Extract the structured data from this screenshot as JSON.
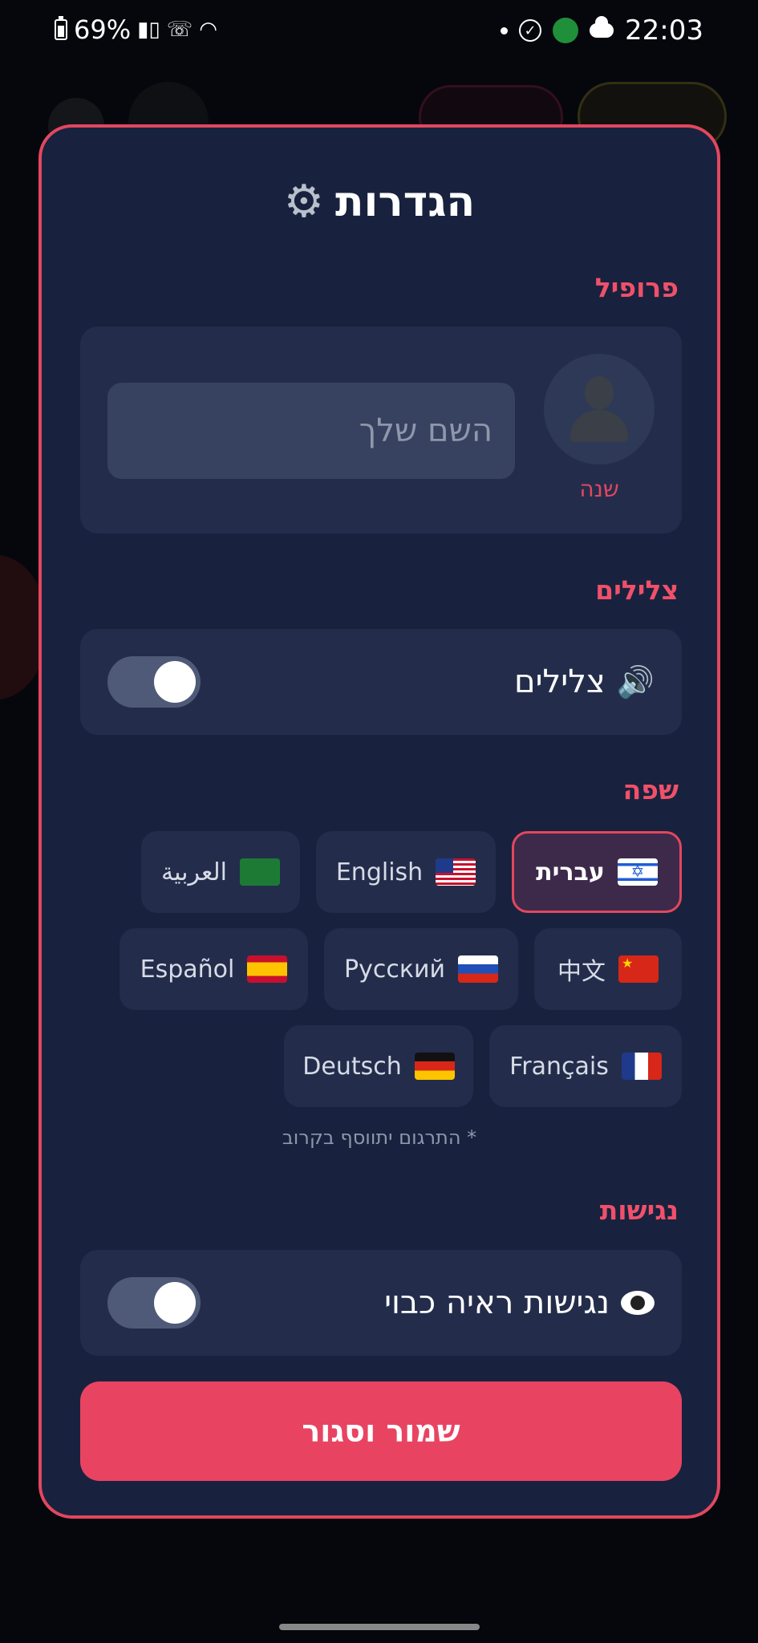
{
  "status_bar": {
    "battery": "69%",
    "time": "22:03",
    "icons": [
      "battery-icon",
      "signal-icon",
      "call-icon",
      "wifi-icon",
      "dot-icon",
      "check-circle-icon",
      "app-badge-icon",
      "cloud-icon"
    ]
  },
  "modal": {
    "title": "הגדרות",
    "title_icon": "gear-icon",
    "profile": {
      "section_label": "פרופיל",
      "avatar_icon": "person-icon",
      "change_label": "שנה",
      "name_placeholder": "השם שלך",
      "name_value": ""
    },
    "sounds": {
      "section_label": "צלילים",
      "row_label": "צלילים",
      "row_icon": "speaker-icon",
      "enabled": true
    },
    "language": {
      "section_label": "שפה",
      "options": [
        {
          "label": "עברית",
          "flag": "flag-il",
          "selected": true
        },
        {
          "label": "English",
          "flag": "flag-us",
          "selected": false
        },
        {
          "label": "العربية",
          "flag": "flag-sa",
          "selected": false
        },
        {
          "label": "中文",
          "flag": "flag-cn",
          "selected": false
        },
        {
          "label": "Русский",
          "flag": "flag-ru",
          "selected": false
        },
        {
          "label": "Español",
          "flag": "flag-es",
          "selected": false
        },
        {
          "label": "Français",
          "flag": "flag-fr",
          "selected": false
        },
        {
          "label": "Deutsch",
          "flag": "flag-de",
          "selected": false
        }
      ],
      "note": "* התרגום יתווסף בקרוב"
    },
    "accessibility": {
      "section_label": "נגישות",
      "row_label": "נגישות ראיה כבוי",
      "row_icon": "eye-icon",
      "enabled": true
    },
    "save_button": "שמור וסגור"
  },
  "colors": {
    "accent": "#e2475f",
    "modal_bg": "#18223e",
    "card_bg": "#232d4b",
    "page_bg": "#05070d"
  }
}
